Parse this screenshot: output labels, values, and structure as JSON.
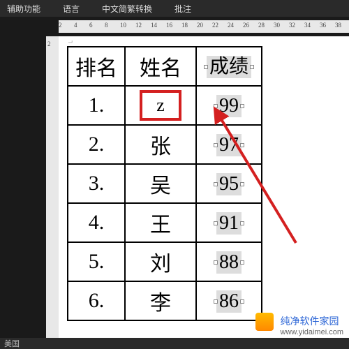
{
  "menu": {
    "accessibility": "辅助功能",
    "language": "语言",
    "trad_simp": "中文简繁转换",
    "annotations": "批注"
  },
  "ruler_numbers": [
    2,
    4,
    6,
    8,
    10,
    12,
    14,
    16,
    18,
    20,
    22,
    24,
    26,
    28,
    30,
    32,
    34,
    36,
    38
  ],
  "vruler": [
    2
  ],
  "table": {
    "headers": {
      "rank": "排名",
      "name": "姓名",
      "score": "成绩"
    },
    "rows": [
      {
        "rank": "1.",
        "name": "z",
        "score": "99",
        "highlight": true
      },
      {
        "rank": "2.",
        "name": "张",
        "score": "97"
      },
      {
        "rank": "3.",
        "name": "吴",
        "score": "95"
      },
      {
        "rank": "4.",
        "name": "王",
        "score": "91"
      },
      {
        "rank": "5.",
        "name": "刘",
        "score": "88"
      },
      {
        "rank": "6.",
        "name": "李",
        "score": "86"
      }
    ]
  },
  "watermark": {
    "brand": "纯净软件家园",
    "url": "www.yidaimei.com"
  },
  "status": {
    "lang": "美国"
  }
}
